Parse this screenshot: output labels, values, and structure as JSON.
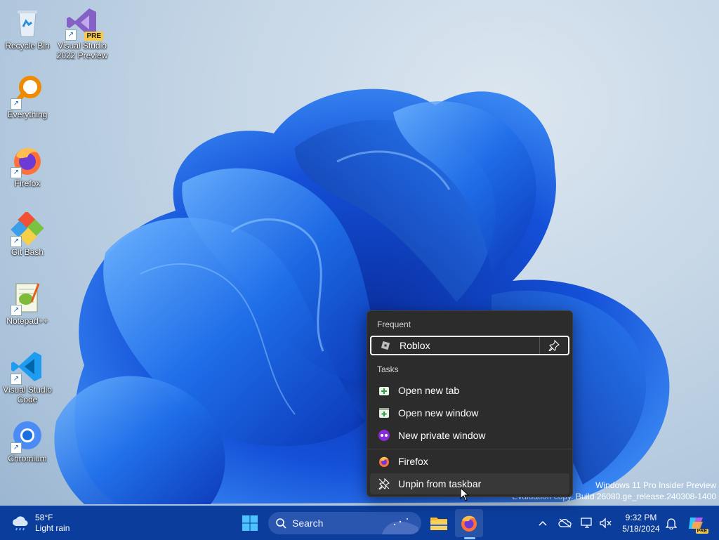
{
  "desktop": {
    "icons": [
      {
        "label": "Recycle Bin",
        "icon": "recycle-bin-icon"
      },
      {
        "label": "Visual Studio 2022 Preview",
        "badge": "PRE",
        "icon": "visual-studio-icon"
      },
      {
        "label": "Everything",
        "icon": "everything-search-icon"
      },
      {
        "label": "Firefox",
        "icon": "firefox-icon"
      },
      {
        "label": "Git Bash",
        "icon": "git-bash-icon"
      },
      {
        "label": "Notepad++",
        "icon": "notepad-plus-plus-icon"
      },
      {
        "label": "Visual Studio Code",
        "icon": "vscode-icon"
      },
      {
        "label": "Chromium",
        "icon": "chromium-icon"
      }
    ]
  },
  "jumplist": {
    "frequent_header": "Frequent",
    "frequent_items": [
      {
        "label": "Roblox",
        "icon": "roblox-icon"
      }
    ],
    "tasks_header": "Tasks",
    "tasks": [
      {
        "label": "Open new tab",
        "icon": "new-tab-icon"
      },
      {
        "label": "Open new window",
        "icon": "new-window-icon"
      },
      {
        "label": "New private window",
        "icon": "private-window-icon"
      }
    ],
    "app_label": "Firefox",
    "unpin_label": "Unpin from taskbar"
  },
  "watermark": {
    "line1": "Windows 11 Pro Insider Preview",
    "line2": "Evaluation copy. Build 26080.ge_release.240308-1400"
  },
  "taskbar": {
    "weather_temp": "58°F",
    "weather_desc": "Light rain",
    "search_label": "Search",
    "time": "9:32 PM",
    "date": "5/18/2024",
    "copilot_badge": "PRE"
  },
  "colors": {
    "taskbar": "#0b3d9c",
    "menu_bg": "#2c2c2c",
    "accent": "#1b6fe0"
  }
}
